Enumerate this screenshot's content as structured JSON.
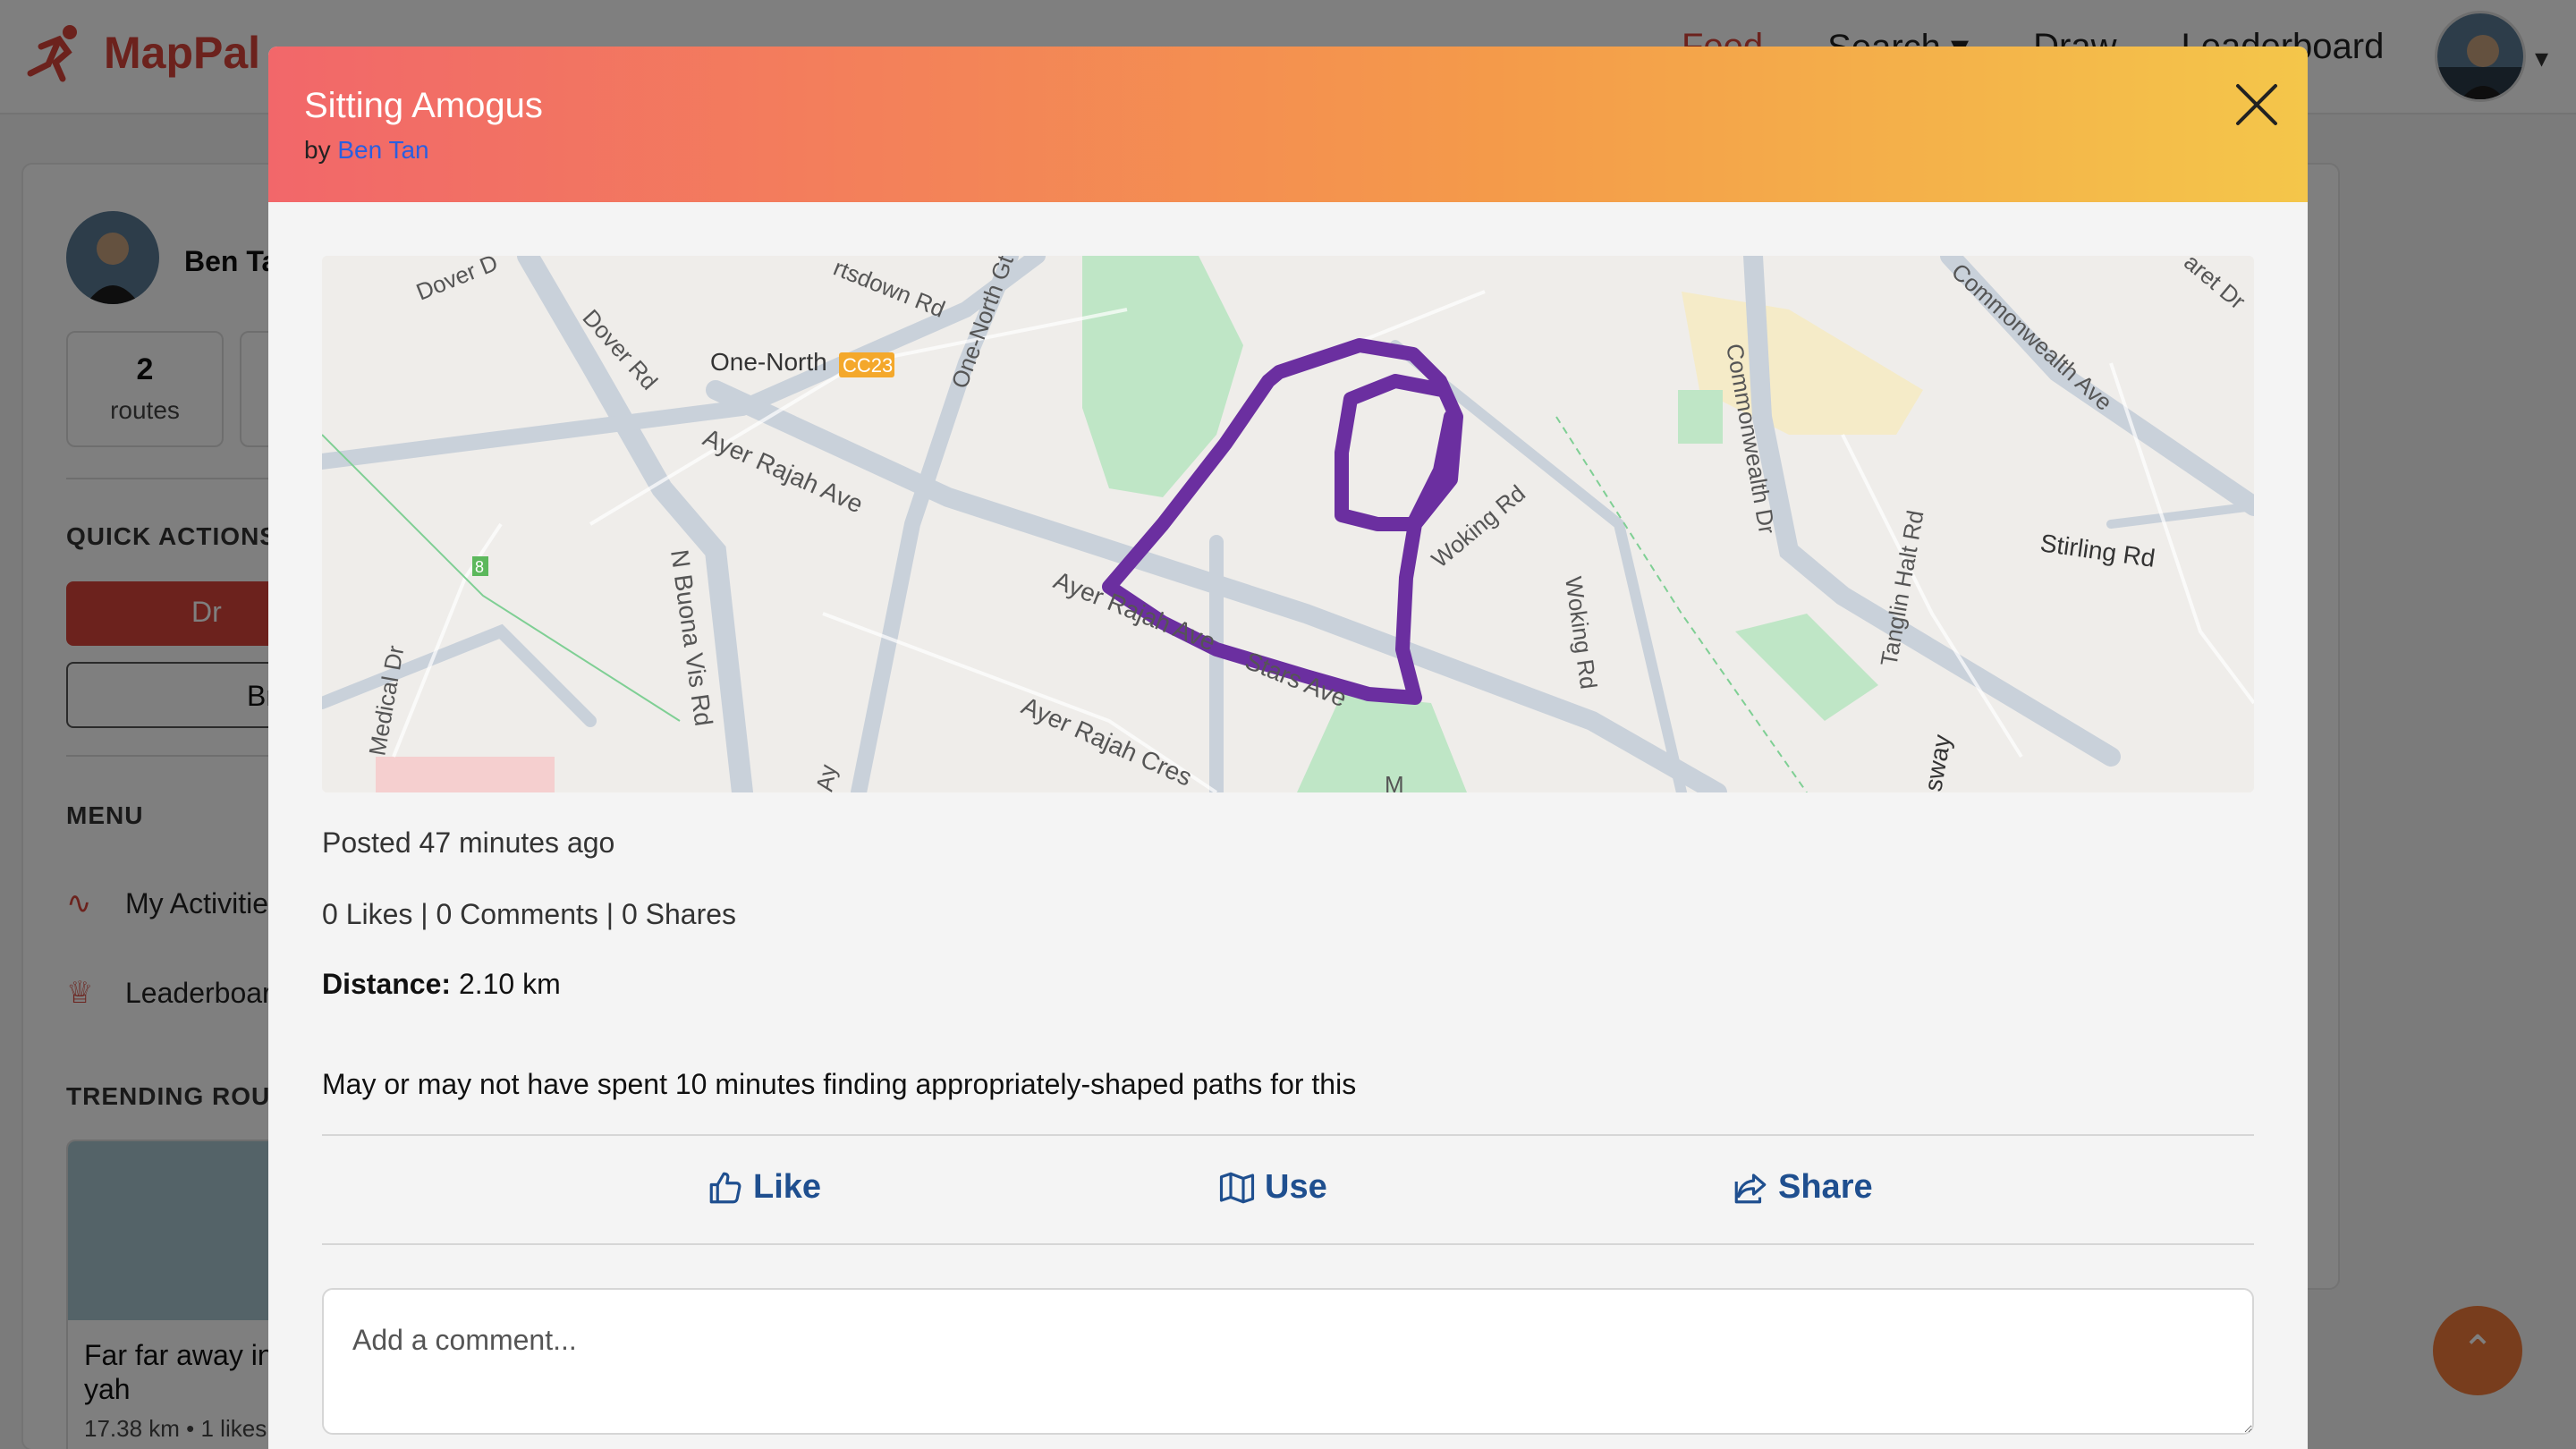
{
  "app": {
    "brand": "MapPal",
    "nav": [
      "Feed",
      "Search",
      "Draw",
      "Leaderboard"
    ],
    "search_caret": "▾"
  },
  "sidebar": {
    "user_name": "Ben Ta",
    "stats": [
      {
        "value": "2",
        "label": "routes"
      }
    ],
    "quick_actions_heading": "QUICK ACTIONS",
    "draw_label": "Dr",
    "browse_label": "Br",
    "menu_heading": "MENU",
    "menu_items": [
      "My Activitie",
      "Leaderboar"
    ],
    "trending_heading": "TRENDING ROUT",
    "trending_card": {
      "title": "Far far away in yah",
      "meta": "17.38 km • 1 likes"
    }
  },
  "modal": {
    "title": "Sitting Amogus",
    "by_prefix": "by",
    "author": "Ben Tan",
    "posted": "Posted 47 minutes ago",
    "stats": "0 Likes | 0 Comments | 0 Shares",
    "distance_label": "Distance:",
    "distance_value": "2.10 km",
    "description": "May or may not have spent 10 minutes finding appropriately-shaped paths for this",
    "actions": {
      "like": "Like",
      "use": "Use",
      "share": "Share"
    },
    "comment_placeholder": "Add a comment..."
  },
  "map_labels": {
    "dover_d": "Dover D",
    "dover_rd": "Dover Rd",
    "one_north": "One-North",
    "station": "CC23",
    "one_north_gt": "One-North Gt",
    "stdown": "rtsdown Rd",
    "ayer_rajah_ave_1": "Ayer Rajah Ave",
    "ayer_rajah_ave_2": "Ayer Rajah Ave",
    "ayer_rajah_cres": "Ayer Rajah Cres",
    "n_buona_vista": "N Buona Vis Rd",
    "medical_dr": "Medical Dr",
    "stars_ave": "Stars Ave",
    "woking_rd_1": "Woking Rd",
    "woking_rd_2": "Woking Rd",
    "commonwealth_dr": "Commonwealth Dr",
    "commonwealth_ave": "Commonwealth Ave",
    "tanglin_halt": "Tanglin Halt Rd",
    "stirling_rd": "Stirling Rd",
    "queensway": "sway",
    "margaret_dr": "aret Dr",
    "marker": "8",
    "ay": "Ay",
    "m": "M"
  },
  "colors": {
    "accent": "#d8453a",
    "route": "#6b2fa0",
    "link": "#2a5fe0",
    "action": "#1f4f8f"
  }
}
